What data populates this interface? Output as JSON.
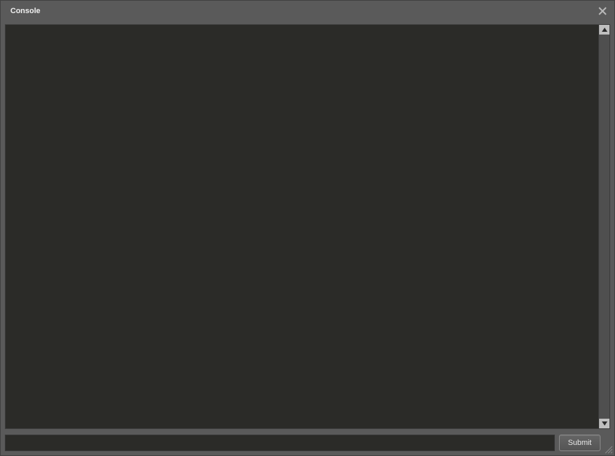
{
  "window": {
    "title": "Console"
  },
  "console": {
    "output": "",
    "command_value": "",
    "command_placeholder": ""
  },
  "buttons": {
    "submit_label": "Submit"
  }
}
